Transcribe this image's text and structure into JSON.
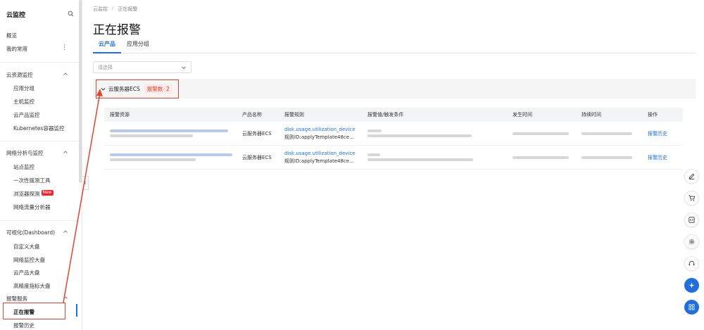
{
  "sidebar": {
    "title": "云监控",
    "items": {
      "overview": "概览",
      "favorites": "我的常用",
      "cloud_resource": "云资源监控",
      "app_group": "应用分组",
      "host_monitor": "主机监控",
      "cloud_product_monitor": "云产品监控",
      "k8s_monitor": "Kubernetes容器监控",
      "network_analysis": "网络分析与监控",
      "site_monitor": "站点监控",
      "one_time_probe": "一次性拨测工具",
      "browser_probe": "浏览器探测",
      "new_badge": "New",
      "traffic_analyzer": "网络流量分析器",
      "dashboard": "可视化(Dashboard)",
      "custom_dashboard": "自定义大盘",
      "network_dashboard": "网络监控大盘",
      "cloud_product_dashboard": "云产品大盘",
      "hp_dashboard": "高精度指标大盘",
      "alarm_service": "报警服务",
      "alarming": "正在报警",
      "alarm_history": "报警历史"
    }
  },
  "breadcrumb": {
    "root": "云监控",
    "sep": "/",
    "current": "正在报警"
  },
  "page_title": "正在报警",
  "tabs": {
    "cloud_product": "云产品",
    "app_group": "应用分组"
  },
  "filter": {
    "placeholder": "请选择"
  },
  "group": {
    "name": "云服务器ECS",
    "alarm_label": "报警数",
    "alarm_count": "2"
  },
  "table": {
    "headers": {
      "resource": "报警资源",
      "product": "产品名称",
      "rule": "报警规则",
      "condition": "报警值/触发条件",
      "time": "发生时间",
      "duration": "持续时间",
      "action": "操作"
    },
    "rows": [
      {
        "product": "云服务器ECS",
        "rule_name": "disk.usage.utilization_device",
        "rule_id": "规则ID:applyTemplate48ce...",
        "action": "报警历史"
      },
      {
        "product": "云服务器ECS",
        "rule_name": "disk.usage.utilization_device",
        "rule_id": "规则ID:applyTemplate48ce...",
        "action": "报警历史"
      }
    ]
  },
  "colors": {
    "accent": "#1f6fde",
    "highlight": "#e0452f"
  }
}
